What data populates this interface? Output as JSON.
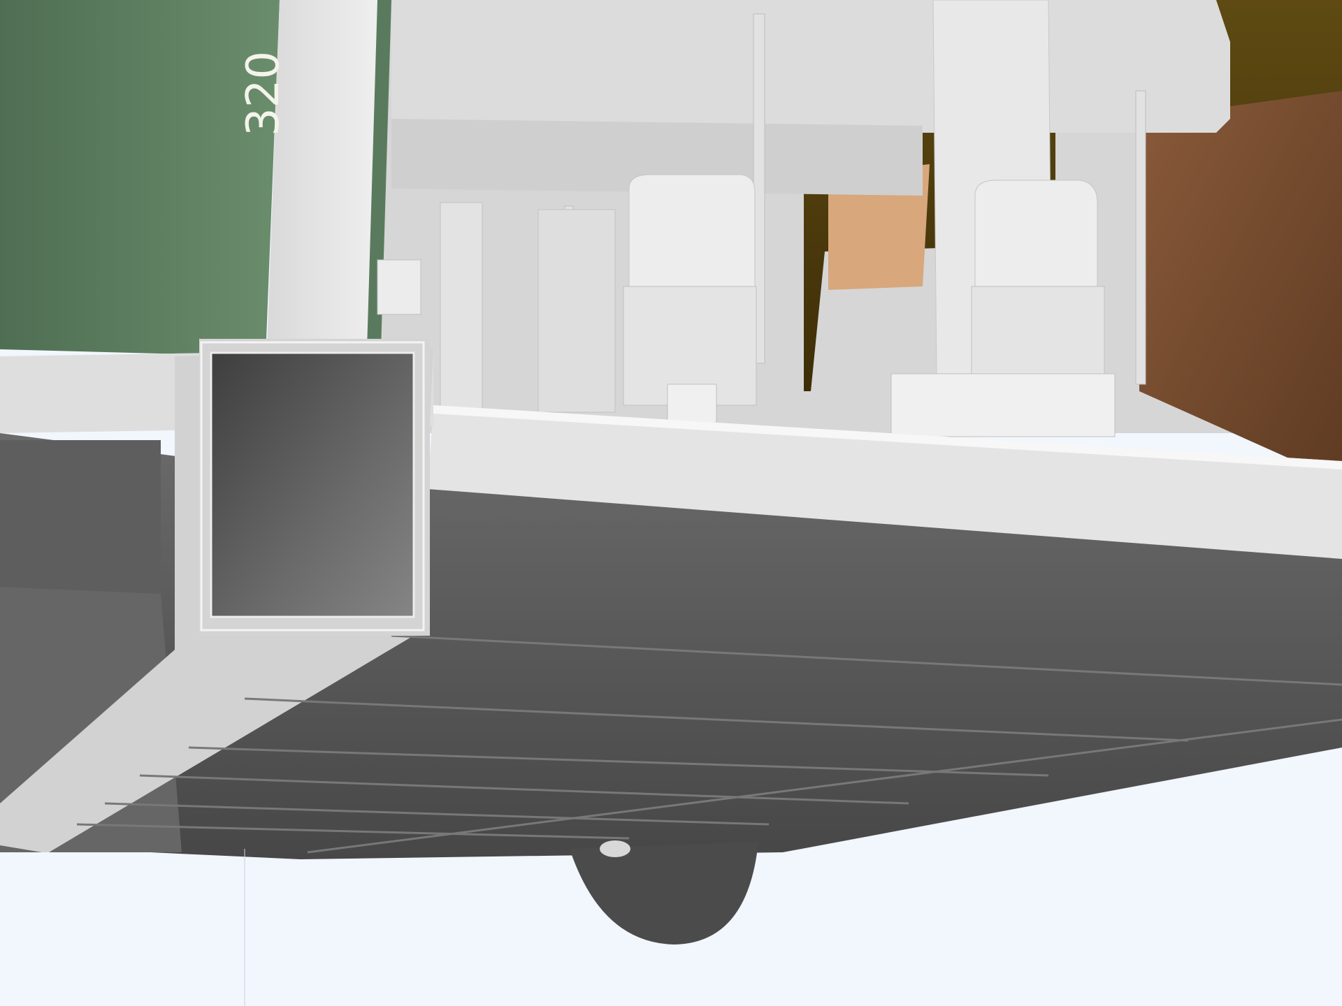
{
  "scene": {
    "dimension_label": "320",
    "colors": {
      "sky": "#f2f6fd",
      "green_panel": "#5b7a5e",
      "white_parts": "#e6e6e6",
      "underside_grey": "#5c5c5c",
      "brown_panel": "#7a5034",
      "olive_panel": "#5a4512",
      "tan_board": "#d8a77c",
      "wheel": "#4a4a4a"
    }
  }
}
